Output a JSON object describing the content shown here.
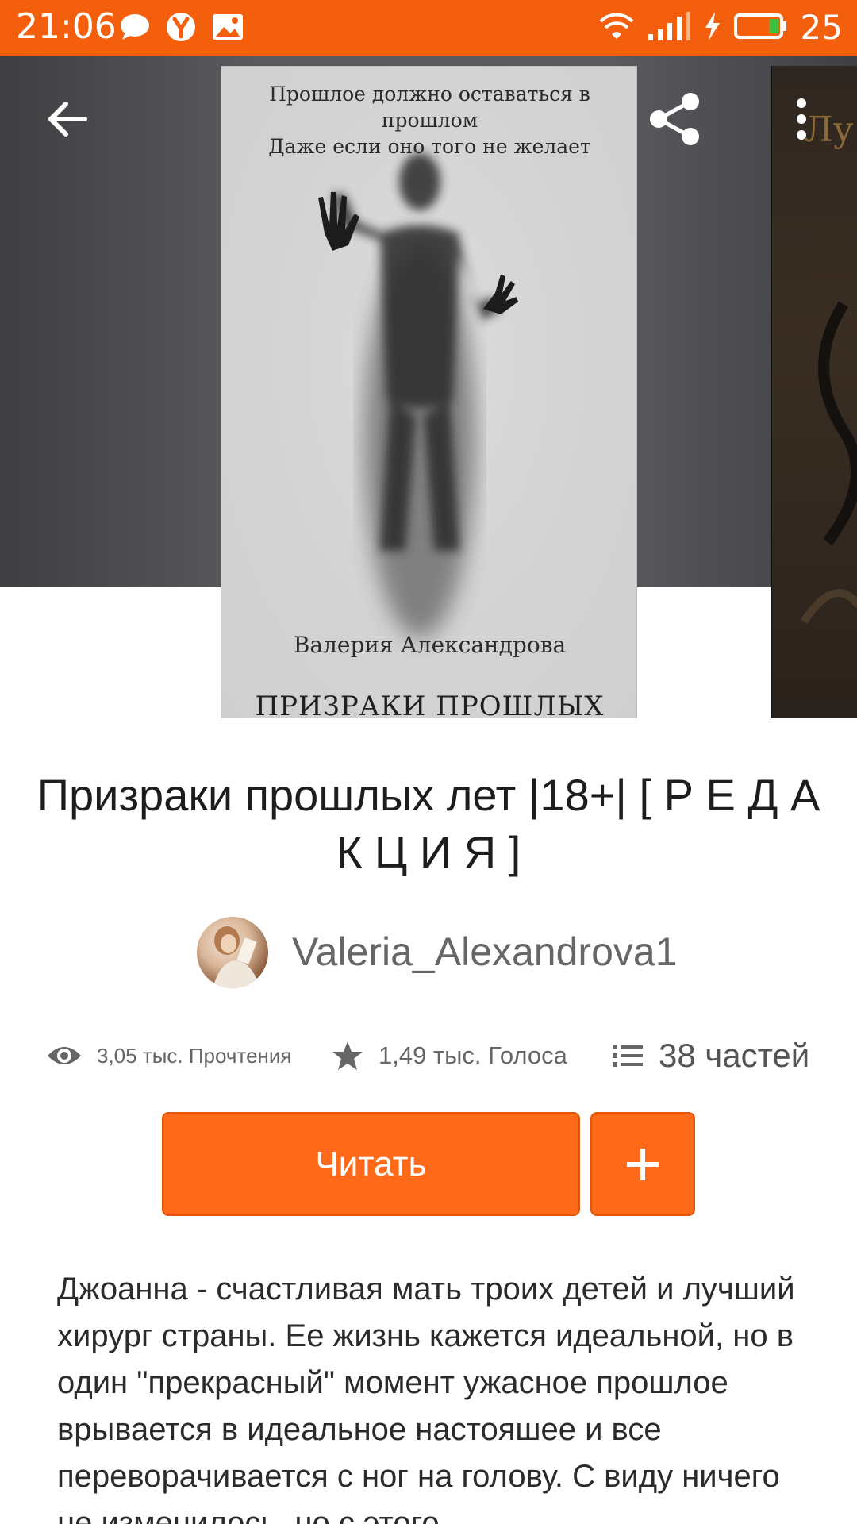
{
  "status_bar": {
    "time": "21:06",
    "left_icons": [
      "chat-bubble-icon",
      "yandex-icon",
      "image-icon"
    ],
    "right_icons": [
      "wifi-icon",
      "signal-icon",
      "charging-icon",
      "battery-icon"
    ],
    "battery_percent": "25"
  },
  "toolbar": {
    "back_icon": "arrow-left-icon",
    "share_icon": "share-icon",
    "more_icon": "more-vertical-icon"
  },
  "cover": {
    "tagline_line1": "Прошлое должно оставаться в прошлом",
    "tagline_line2": "Даже если оно того не желает",
    "author": "Валерия Александрова",
    "title": "ПРИЗРАКИ ПРОШЛЫХ ЛЕТ"
  },
  "next_cover": {
    "visible_text": "Лу"
  },
  "story": {
    "title": "Призраки прошлых лет |18+| [ Р Е Д А К Ц И Я ]",
    "author": "Valeria_Alexandrova1",
    "reads": "3,05 тыс. Прочтения",
    "votes": "1,49 тыс. Голоса",
    "parts": "38 частей",
    "description": "Джоанна - счастливая мать троих детей и лучший хирург страны. Ее жизнь кажется идеальной, но в один \"прекрасный\" момент ужасное прошлое врывается в идеальное настояшее и все переворачивается с ног на голову. С виду ничего не изменилось, но с этого"
  },
  "actions": {
    "read_label": "Читать",
    "add_icon": "plus-icon"
  },
  "colors": {
    "status_bar": "#f35f0c",
    "accent": "#ff6a1a",
    "hero_bg": "#58585c"
  }
}
